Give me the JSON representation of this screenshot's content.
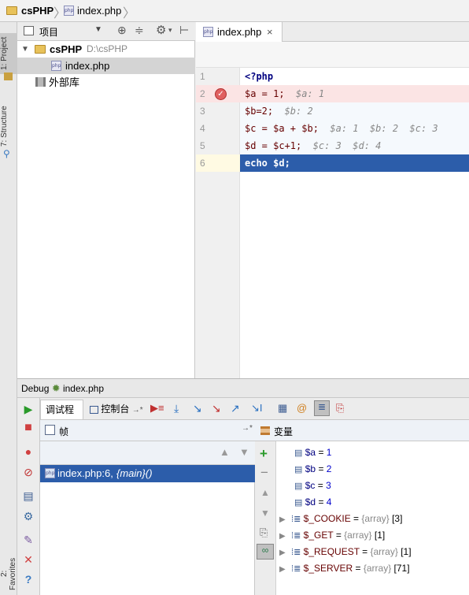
{
  "breadcrumb": {
    "project": "csPHP",
    "file": "index.php"
  },
  "sidebar_tabs": {
    "project": "1: Project",
    "structure": "7: Structure",
    "favorites": "2: Favorites"
  },
  "project_panel": {
    "view_label": "项目",
    "root_name": "csPHP",
    "root_path": "D:\\csPHP",
    "file": "index.php",
    "external": "外部库"
  },
  "editor": {
    "tab_label": "index.php",
    "tab_close": "×",
    "line_numbers": [
      "1",
      "2",
      "3",
      "4",
      "5",
      "6"
    ],
    "lines": [
      {
        "code": "<?php",
        "hint": ""
      },
      {
        "code": "$a = 1;",
        "hint": "$a: 1"
      },
      {
        "code": "$b=2;",
        "hint": "$b: 2"
      },
      {
        "code": "$c = $a + $b;",
        "hint": "$a: 1  $b: 2  $c: 3"
      },
      {
        "code": "$d = $c+1;",
        "hint": "$c: 3  $d: 4"
      },
      {
        "code": "echo $d;",
        "hint": ""
      }
    ]
  },
  "debug": {
    "title_prefix": "Debug",
    "title_file": "index.php",
    "tab_debugger": "调试程序",
    "tab_console": "控制台",
    "frames_label": "帧",
    "variables_label": "变量",
    "frame_file": "index.php:6,",
    "frame_scope": "{main}()",
    "variables": [
      {
        "name": "$a",
        "eq": " = ",
        "value": "1"
      },
      {
        "name": "$b",
        "eq": " = ",
        "value": "2"
      },
      {
        "name": "$c",
        "eq": " = ",
        "value": "3"
      },
      {
        "name": "$d",
        "eq": " = ",
        "value": "4"
      }
    ],
    "globals": [
      {
        "name": "$_COOKIE",
        "eq": " = ",
        "type": "{array}",
        "count": "[3]"
      },
      {
        "name": "$_GET",
        "eq": " = ",
        "type": "{array}",
        "count": "[1]"
      },
      {
        "name": "$_REQUEST",
        "eq": " = ",
        "type": "{array}",
        "count": "[1]"
      },
      {
        "name": "$_SERVER",
        "eq": " = ",
        "type": "{array}",
        "count": "[71]"
      }
    ]
  },
  "colors": {
    "selection": "#2c5daa",
    "breakpoint_line": "#fbe4e4",
    "current_line": "#fffae3",
    "accent": "#3575c8"
  }
}
